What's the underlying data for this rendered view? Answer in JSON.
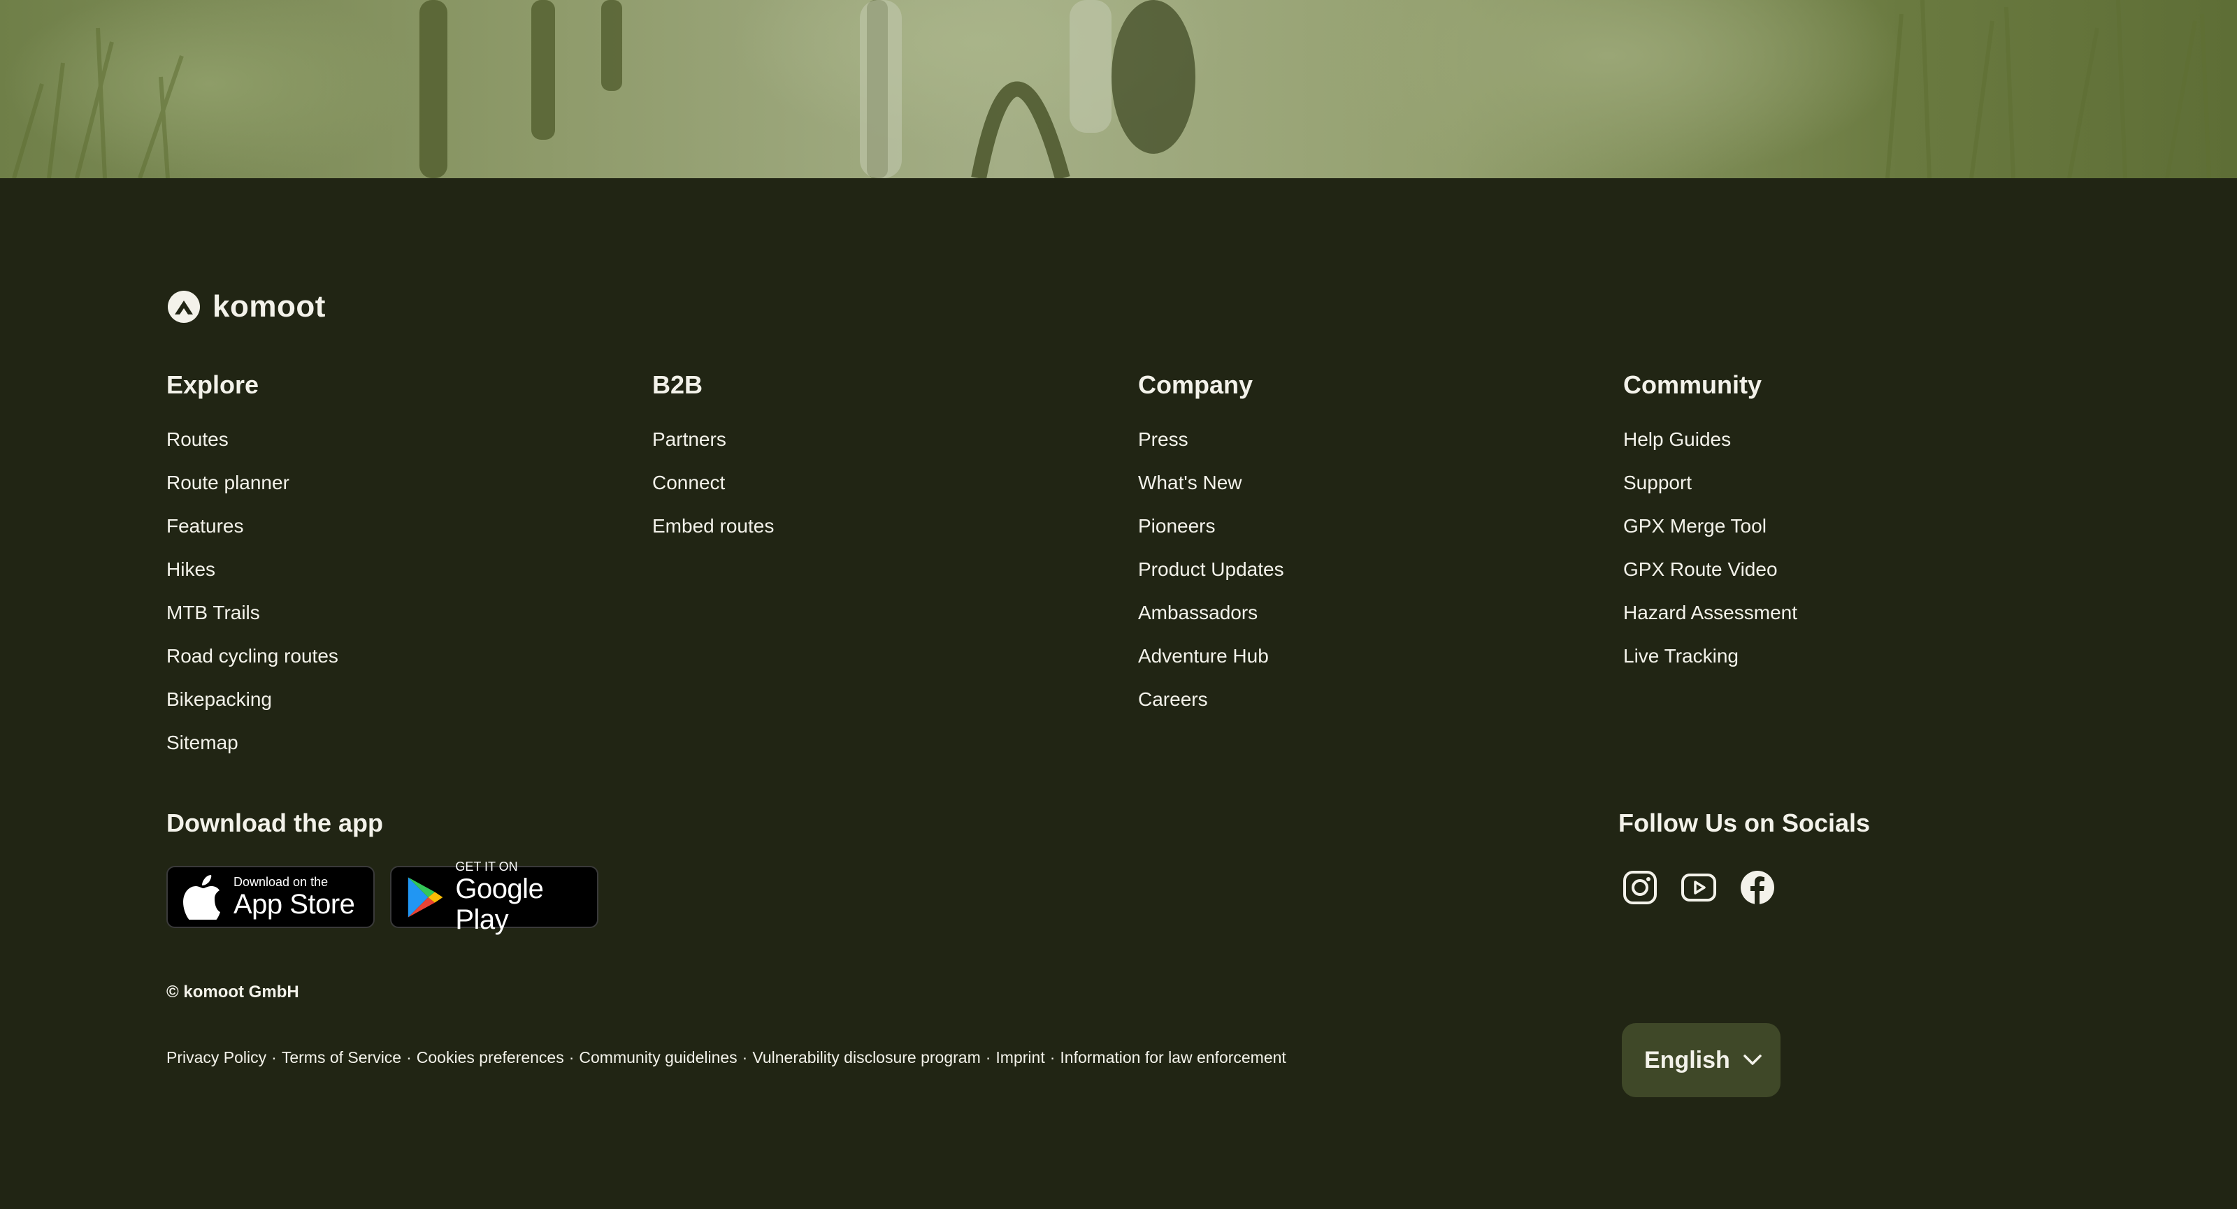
{
  "brand": {
    "name": "komoot"
  },
  "columns": [
    {
      "title": "Explore",
      "links": [
        "Routes",
        "Route planner",
        "Features",
        "Hikes",
        "MTB Trails",
        "Road cycling routes",
        "Bikepacking",
        "Sitemap"
      ]
    },
    {
      "title": "B2B",
      "links": [
        "Partners",
        "Connect",
        "Embed routes"
      ]
    },
    {
      "title": "Company",
      "links": [
        "Press",
        "What's New",
        "Pioneers",
        "Product Updates",
        "Ambassadors",
        "Adventure Hub",
        "Careers"
      ]
    },
    {
      "title": "Community",
      "links": [
        "Help Guides",
        "Support",
        "GPX Merge Tool",
        "GPX Route Video",
        "Hazard Assessment",
        "Live Tracking"
      ]
    }
  ],
  "download": {
    "title": "Download the app",
    "app_store": {
      "small": "Download on the",
      "big": "App Store"
    },
    "google_play": {
      "small": "GET IT ON",
      "big": "Google Play"
    }
  },
  "socials": {
    "title": "Follow Us on Socials",
    "icons": [
      "instagram-icon",
      "youtube-icon",
      "facebook-icon"
    ]
  },
  "copyright": "© komoot GmbH",
  "legal_links": [
    "Privacy Policy",
    "Terms of Service",
    "Cookies preferences",
    "Community guidelines",
    "Vulnerability disclosure program",
    "Imprint",
    "Information for law enforcement"
  ],
  "legal_separator": "·",
  "language": {
    "selected": "English"
  },
  "colors": {
    "background": "#212514",
    "text": "#f3f2ea",
    "language_button": "#3f4828",
    "hero_tint": "#8a9a5b"
  }
}
